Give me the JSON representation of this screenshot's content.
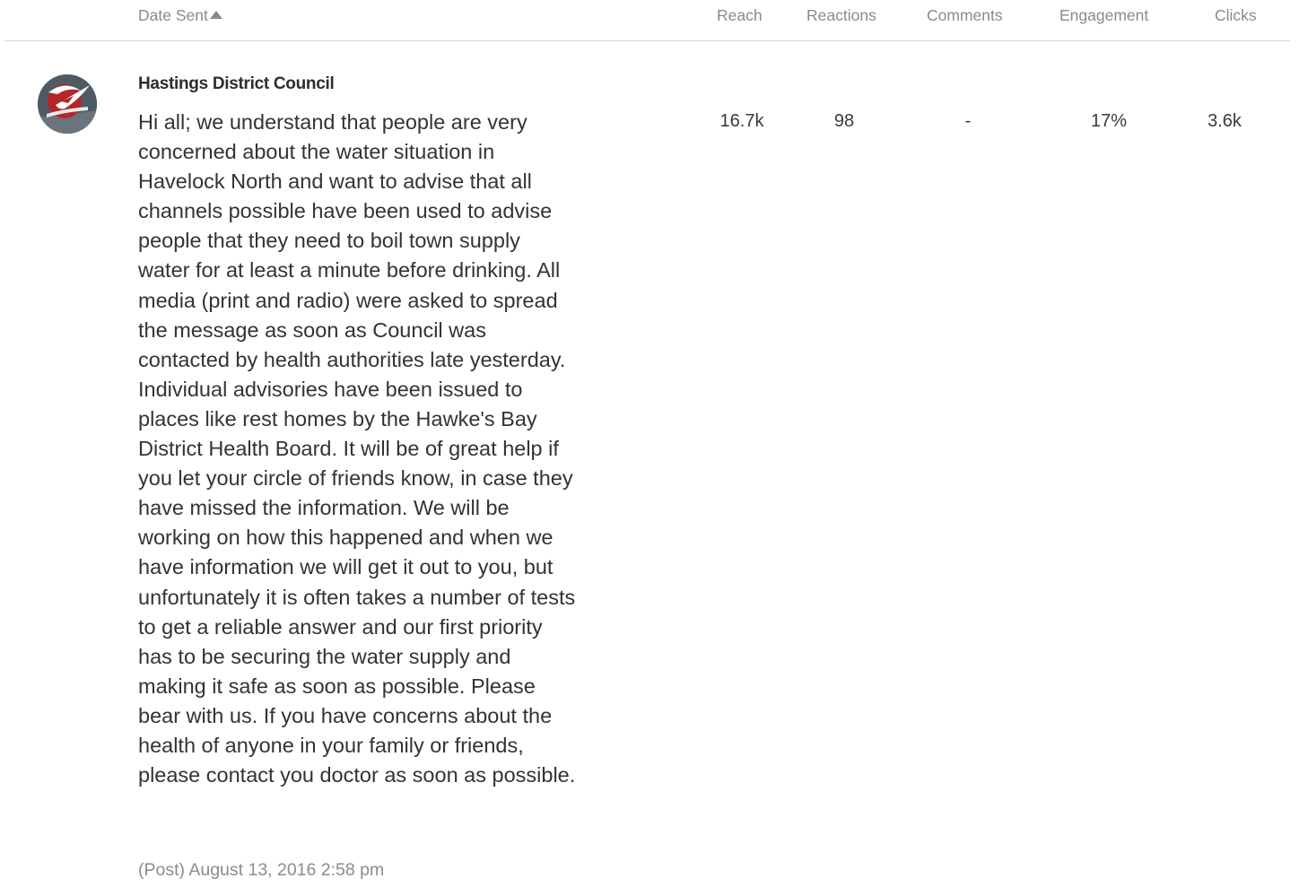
{
  "table": {
    "columns": {
      "date_sent": "Date Sent",
      "reach": "Reach",
      "reactions": "Reactions",
      "comments": "Comments",
      "engagement": "Engagement",
      "clicks": "Clicks"
    },
    "sort": {
      "column": "date_sent",
      "direction": "ascending",
      "icon": "sort-ascending-icon"
    }
  },
  "post": {
    "author": "Hastings District Council",
    "avatar_icon": "council-logo-icon",
    "text": "Hi all; we understand that people are very concerned about the water situation in Havelock North and want to advise that all channels possible have been used to advise people that they need to boil town supply water for at least a minute before drinking. All media (print and radio) were asked to spread the message as soon as Council was contacted by health authorities late yesterday. Individual advisories have been issued to places like rest homes by the Hawke's Bay District Health Board. It will be of great help if you let your circle of friends know, in case they have missed the information. We will be working on how this happened and when we have information we will get it out to you, but unfortunately it is often takes a number of tests to get a reliable answer and our first priority has to be securing the water supply and making it safe as soon as possible. Please bear with us. If you have concerns about the health of anyone in your family or friends, please contact you doctor as soon as possible.",
    "meta": "(Post) August 13, 2016 2:58 pm",
    "metrics": {
      "reach": "16.7k",
      "reactions": "98",
      "comments": "-",
      "engagement": "17%",
      "clicks": "3.6k"
    }
  },
  "colors": {
    "header_text": "#8a8a8a",
    "body_text": "#333333",
    "avatar_bg": "#4f5a63",
    "logo_red": "#b3262b",
    "rule": "#d6d6d6"
  }
}
